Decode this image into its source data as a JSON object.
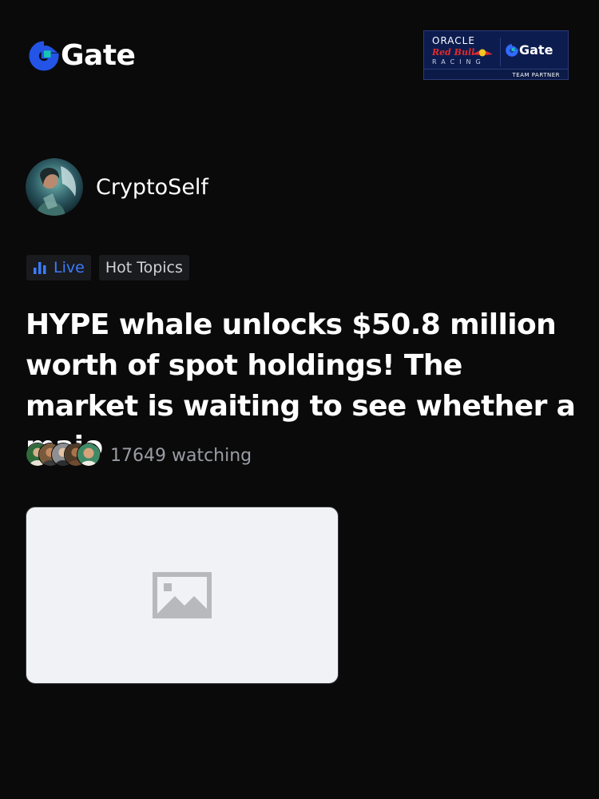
{
  "header": {
    "brand": "Gate",
    "partner_badge": {
      "line1": "ORACLE",
      "line2": "Red Bull",
      "line3": "RACING",
      "brand": "Gate",
      "footer": "TEAM PARTNER"
    }
  },
  "author": {
    "name": "CryptoSelf"
  },
  "tags": {
    "live": "Live",
    "hot_topics": "Hot Topics"
  },
  "post": {
    "title": "HYPE whale unlocks $50.8 million worth of spot holdings! The market is waiting to see whether a majo"
  },
  "watching": {
    "text": "17649 watching"
  },
  "colors": {
    "background": "#0a0a0b",
    "accent": "#3b7bff",
    "tag_bg": "#1a1b1e",
    "muted_text": "#9a9ca3",
    "placeholder_bg": "#f1f2f5"
  },
  "icons": {
    "logo": "gate-logo-icon",
    "live": "bar-chart-icon",
    "media": "image-placeholder-icon"
  }
}
